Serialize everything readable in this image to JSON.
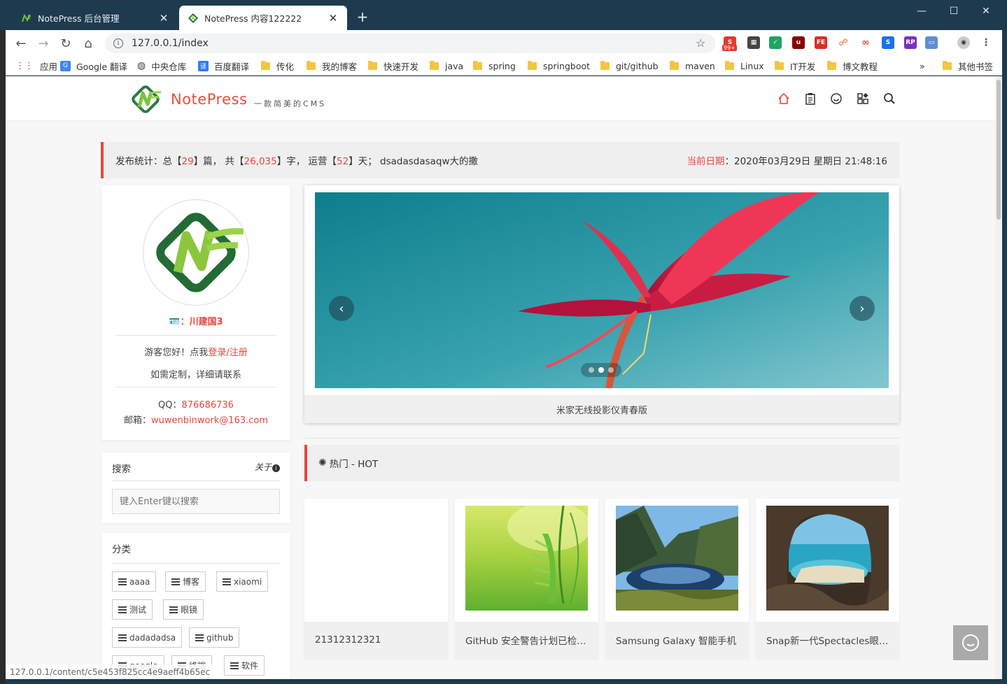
{
  "browser": {
    "tabs": [
      {
        "title": "NotePress 后台管理"
      },
      {
        "title": "NotePress 内容122222"
      }
    ],
    "url": "127.0.0.1/index",
    "extension_badge": "99+",
    "bookmarks": [
      {
        "label": "应用",
        "icon": "apps-grid-icon"
      },
      {
        "label": "Google 翻译",
        "icon": "google-translate-icon"
      },
      {
        "label": "中央仓库",
        "icon": "globe-icon"
      },
      {
        "label": "百度翻译",
        "icon": "baidu-translate-icon"
      },
      {
        "label": "传化",
        "icon": "folder-icon"
      },
      {
        "label": "我的博客",
        "icon": "folder-icon"
      },
      {
        "label": "快速开发",
        "icon": "folder-icon"
      },
      {
        "label": "java",
        "icon": "folder-icon"
      },
      {
        "label": "spring",
        "icon": "folder-icon"
      },
      {
        "label": "springboot",
        "icon": "folder-icon"
      },
      {
        "label": "git/github",
        "icon": "folder-icon"
      },
      {
        "label": "maven",
        "icon": "folder-icon"
      },
      {
        "label": "Linux",
        "icon": "folder-icon"
      },
      {
        "label": "IT开发",
        "icon": "folder-icon"
      },
      {
        "label": "博文教程",
        "icon": "folder-icon"
      }
    ],
    "more_bookmarks": "»",
    "other_bookmarks": "其他书签",
    "status_url": "127.0.0.1/content/c5e453f825cc4e9aeff4b65ec"
  },
  "site": {
    "brand": "NotePress",
    "slogan": "一款简美的CMS",
    "nav_icons": [
      "home-icon",
      "clipboard-icon",
      "smile-icon",
      "apps-icon",
      "search-icon"
    ],
    "accent": "#e8473c",
    "brand_green": "#2b7a3d"
  },
  "stats": {
    "label": "发布统计：",
    "p1": "总【",
    "posts": "29",
    "p2": "】篇， 共【",
    "words": "26,035",
    "p3": "】字， 运营【",
    "days": "52",
    "p4": "】天； dsadasdasaqw大的撒",
    "date_label": "当前日期",
    "date_value": "：2020年03月29日 星期日 21:48:16"
  },
  "profile": {
    "name_prefix": "：",
    "name": "川建国3",
    "greeting": "游客您好！点我",
    "login_link": "登录/注册",
    "custom": "如需定制，详细请联系",
    "qq_label": "QQ：",
    "qq": "876686736",
    "email_label": "邮箱：",
    "email": "wuwenbinwork@163.com"
  },
  "search": {
    "title": "搜索",
    "about": "关于",
    "placeholder": "键入Enter键以搜索"
  },
  "categories": {
    "title": "分类",
    "items": [
      "aaaa",
      "博客",
      "xiaomi",
      "测试",
      "眼镜",
      "dadadadsa",
      "github",
      "google",
      "终端",
      "软件"
    ]
  },
  "carousel": {
    "caption": "米家无线投影仪青春版",
    "slide_count": 3,
    "active_index": 1
  },
  "hot": {
    "title": "热门 - HOT",
    "posts": [
      {
        "title": "21312312321",
        "image": "none"
      },
      {
        "title": "GitHub 安全警告计划已检…",
        "image": "green-leaf"
      },
      {
        "title": "Samsung Galaxy 智能手机",
        "image": "mountain-lake"
      },
      {
        "title": "Snap新一代Spectacles眼…",
        "image": "sea-cave"
      }
    ]
  }
}
